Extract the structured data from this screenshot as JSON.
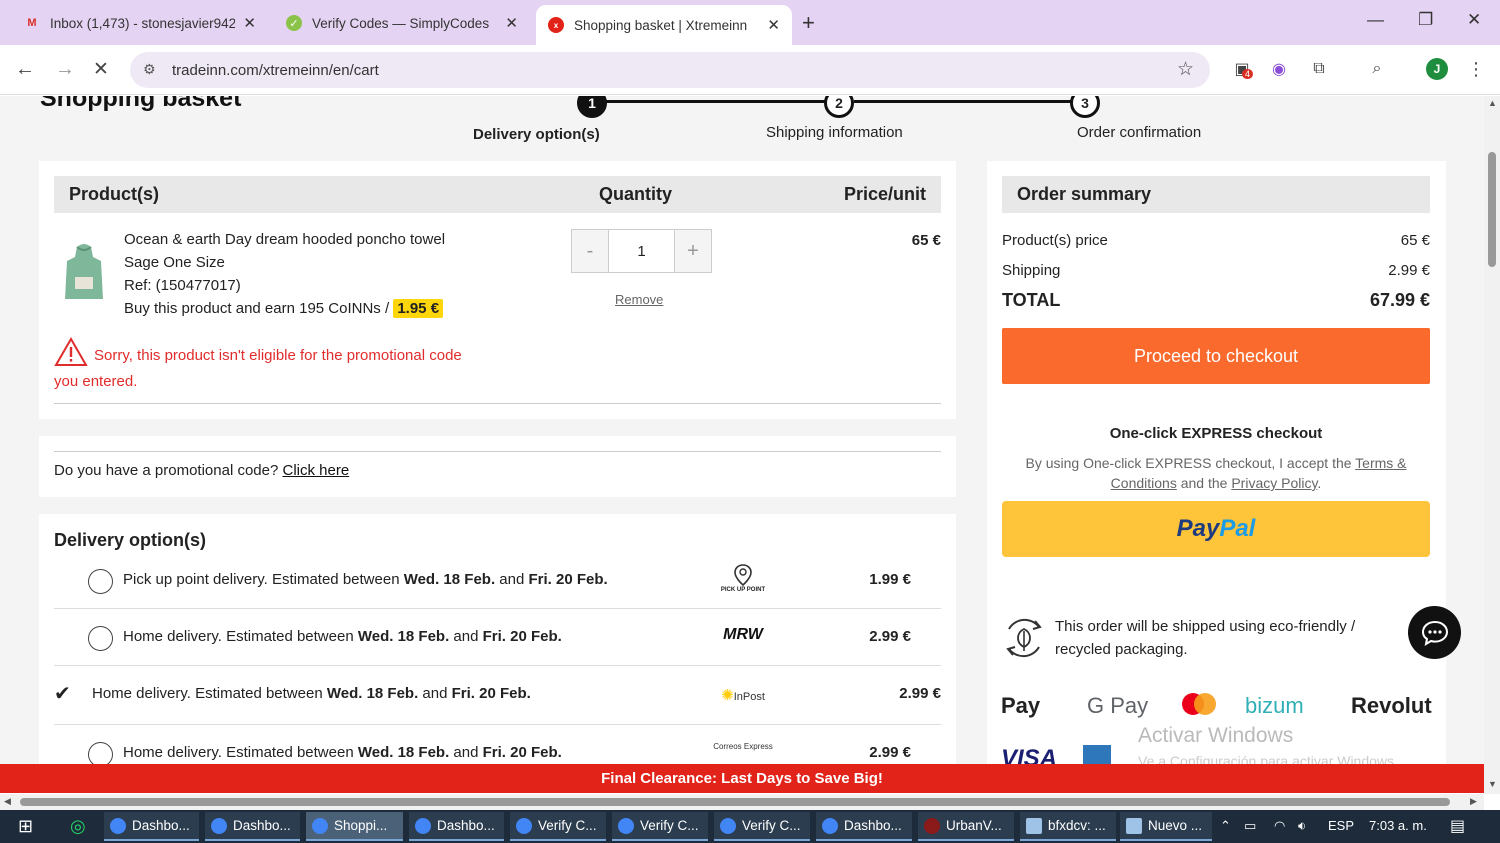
{
  "browser": {
    "tabs": [
      {
        "title": "Inbox (1,473) - stonesjavier942@",
        "favicon": "gmail-icon"
      },
      {
        "title": "Verify Codes — SimplyCodes",
        "favicon": "simplycodes-icon"
      },
      {
        "title": "Shopping basket | Xtremeinn",
        "favicon": "xtremeinn-icon",
        "active": true
      }
    ],
    "url": "tradeinn.com/xtremeinn/en/cart",
    "profile_initial": "J",
    "extension_badge": "4"
  },
  "page": {
    "title": "Shopping basket",
    "steps": [
      {
        "number": "1",
        "label": "Delivery option(s)"
      },
      {
        "number": "2",
        "label": "Shipping information"
      },
      {
        "number": "3",
        "label": "Order confirmation"
      }
    ],
    "cart": {
      "headers": {
        "product": "Product(s)",
        "quantity": "Quantity",
        "price": "Price/unit"
      },
      "item": {
        "name": "Ocean & earth Day dream hooded poncho towel",
        "variant": "Sage One Size",
        "ref": "Ref: (150477017)",
        "coins_text": "Buy this product and earn 195 CoINNs /",
        "coins_value": "1.95 €",
        "quantity": "1",
        "qty_minus": "-",
        "qty_plus": "+",
        "remove": "Remove",
        "price": "65 €"
      },
      "warning": "Sorry, this product isn't eligible for the promotional code you entered."
    },
    "promo": {
      "question": "Do you have a promotional code?",
      "link": "Click here"
    },
    "delivery": {
      "title": "Delivery option(s)",
      "options": [
        {
          "prefix": "Pick up point delivery. Estimated between ",
          "date1": "Wed. 18 Feb.",
          "mid": " and ",
          "date2": "Fri. 20 Feb.",
          "logo": "PICK UP POINT",
          "price": "1.99 €",
          "selected": false
        },
        {
          "prefix": "Home delivery. Estimated between ",
          "date1": "Wed. 18 Feb.",
          "mid": " and ",
          "date2": "Fri. 20 Feb.",
          "logo": "MRW",
          "price": "2.99 €",
          "selected": false
        },
        {
          "prefix": "Home delivery. Estimated between ",
          "date1": "Wed. 18 Feb.",
          "mid": " and ",
          "date2": "Fri. 20 Feb.",
          "logo": "InPost",
          "price": "2.99 €",
          "selected": true
        },
        {
          "prefix": "Home delivery. Estimated between ",
          "date1": "Wed. 18 Feb.",
          "mid": " and ",
          "date2": "Fri. 20 Feb.",
          "logo": "Correos Express",
          "price": "2.99 €",
          "selected": false
        }
      ]
    },
    "summary": {
      "title": "Order summary",
      "product_price_label": "Product(s) price",
      "product_price": "65 €",
      "shipping_label": "Shipping",
      "shipping": "2.99 €",
      "total_label": "TOTAL",
      "total": "67.99 €",
      "checkout": "Proceed to checkout",
      "express_title_pre": "One-click ",
      "express_title_bold": "EXPRESS checkout",
      "express_text_pre": "By using One-click EXPRESS checkout, I accept the ",
      "terms_link": "Terms & Conditions",
      "express_text_mid": " and the ",
      "privacy_link": "Privacy Policy",
      "express_text_end": ".",
      "paypal_1": "Pay",
      "paypal_2": "Pal",
      "eco_text": "This order will be shipped using eco-friendly / recycled packaging.",
      "payment_logos": [
        "Pay",
        "G Pay",
        "bizum",
        "Revolut",
        "VISA"
      ]
    },
    "banner": "Final Clearance: Last Days to Save Big!",
    "watermark_title": "Activar Windows",
    "watermark_sub": "Ve a Configuración para activar Windows."
  },
  "taskbar": {
    "items": [
      "Dashbo...",
      "Dashbo...",
      "Shoppi...",
      "Dashbo...",
      "Verify C...",
      "Verify C...",
      "Verify C...",
      "Dashbo...",
      "UrbanV...",
      "bfxdcv: ...",
      "Nuevo ..."
    ],
    "lang": "ESP",
    "time": "7:03 a. m."
  },
  "colors": {
    "accent": "#f96a2c",
    "paypal": "#fec43a",
    "banner": "#e2231a",
    "warning": "#e02c2c",
    "coin": "#ffd60a"
  }
}
